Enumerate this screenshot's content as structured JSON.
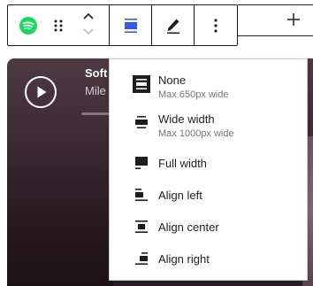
{
  "colors": {
    "accent": "#3858e9",
    "spotify_green": "#1ed760",
    "text": "#1e1e1e",
    "muted": "#757575"
  },
  "player": {
    "title": "Soft",
    "artist": "Mile",
    "play_icon": "play-icon"
  },
  "toolbar": {
    "block_icon": "spotify-icon",
    "drag_icon": "drag-handle-icon",
    "move_up_icon": "chevron-up-icon",
    "move_down_icon": "chevron-down-icon",
    "align_icon": "align-none-icon",
    "edit_icon": "pencil-icon",
    "more_icon": "more-vertical-icon",
    "add_icon": "plus-icon"
  },
  "align_menu": {
    "items": [
      {
        "label": "None",
        "desc": "Max 650px wide",
        "icon": "align-none-icon"
      },
      {
        "label": "Wide width",
        "desc": "Max 1000px wide",
        "icon": "align-wide-icon"
      },
      {
        "label": "Full width",
        "icon": "align-full-icon"
      },
      {
        "label": "Align left",
        "icon": "align-left-icon"
      },
      {
        "label": "Align center",
        "icon": "align-center-icon"
      },
      {
        "label": "Align right",
        "icon": "align-right-icon"
      }
    ]
  }
}
